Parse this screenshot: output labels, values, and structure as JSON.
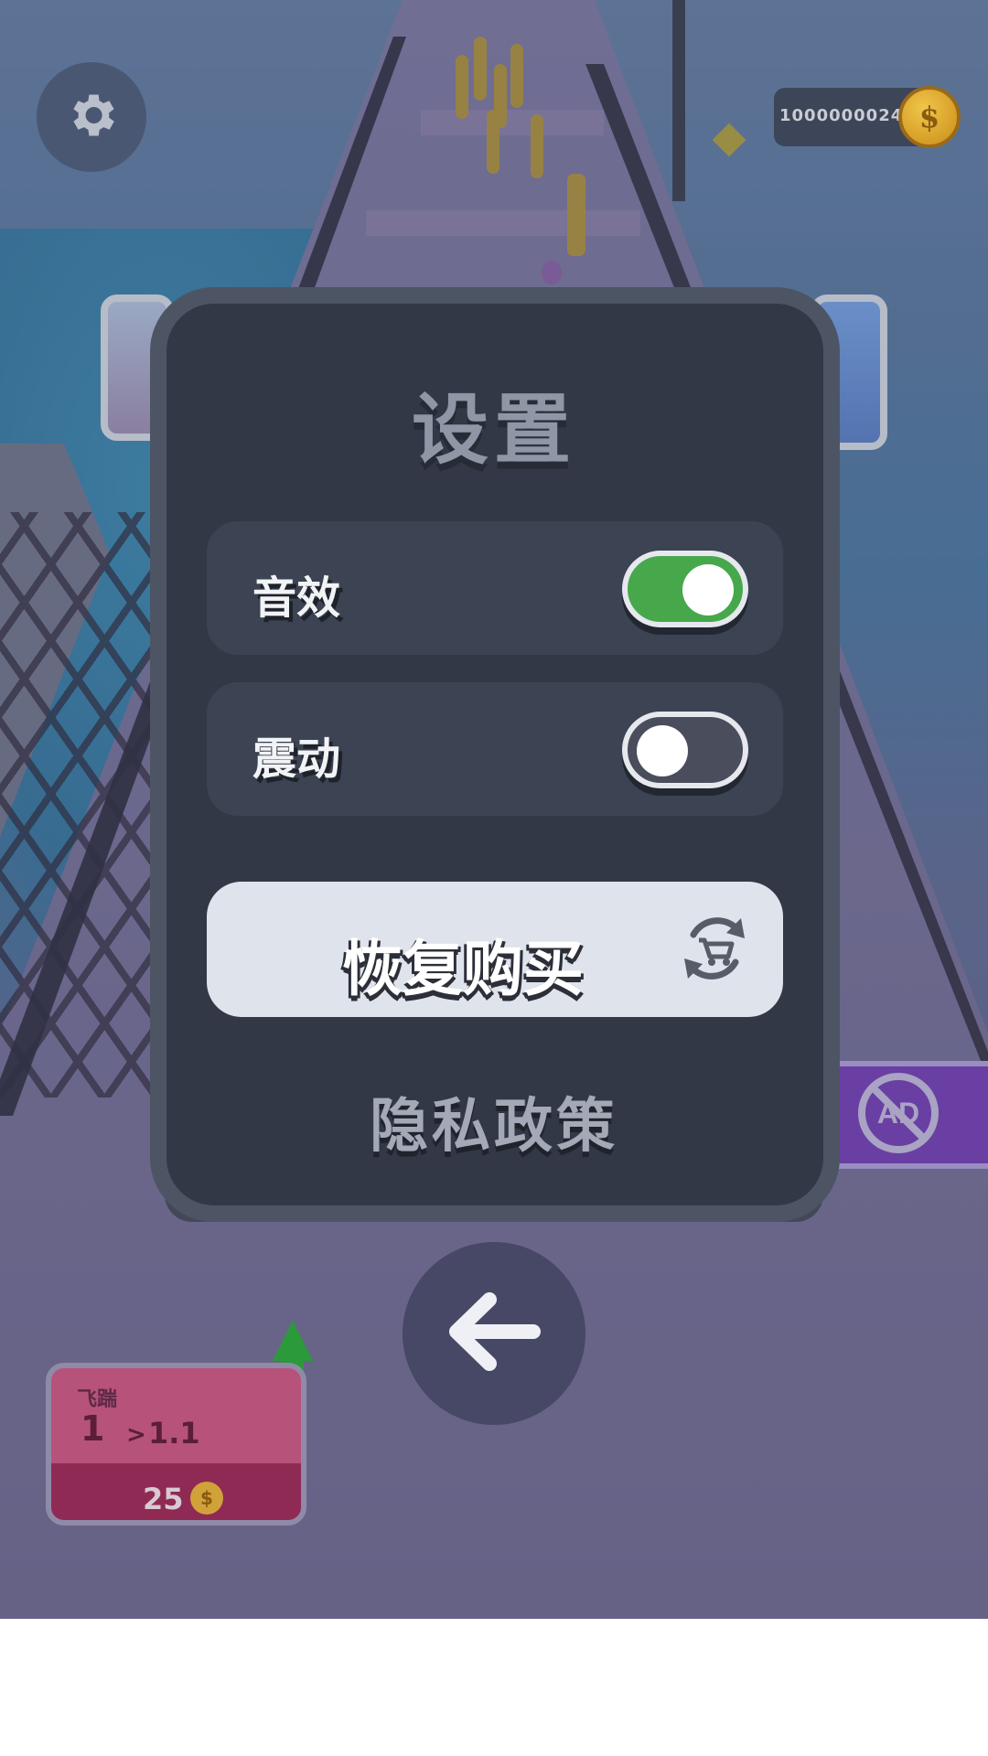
{
  "hud": {
    "coin_count": "1000000024",
    "coin_symbol": "$"
  },
  "settings": {
    "title": "设置",
    "sound": {
      "label": "音效",
      "enabled": true
    },
    "vibration": {
      "label": "震动",
      "enabled": false
    },
    "restore_purchase_label": "恢复购买",
    "privacy_policy_label": "隐私政策"
  },
  "upgrade_card": {
    "title": "飞踹",
    "level_from": "1",
    "arrow": ">",
    "level_to": "1.1",
    "cost": "25",
    "coin_symbol": "$"
  },
  "icons": [
    "gear-icon",
    "coin-icon",
    "cart-refresh-icon",
    "back-arrow-icon",
    "no-ads-icon",
    "upgrade-arrow-icon"
  ],
  "colors": {
    "panel_bg": "#323846",
    "panel_border": "#4d5565",
    "toggle_on": "#46a84b",
    "toggle_off": "#4a4d5c",
    "restore_button_bg": "#dfe3ec"
  }
}
